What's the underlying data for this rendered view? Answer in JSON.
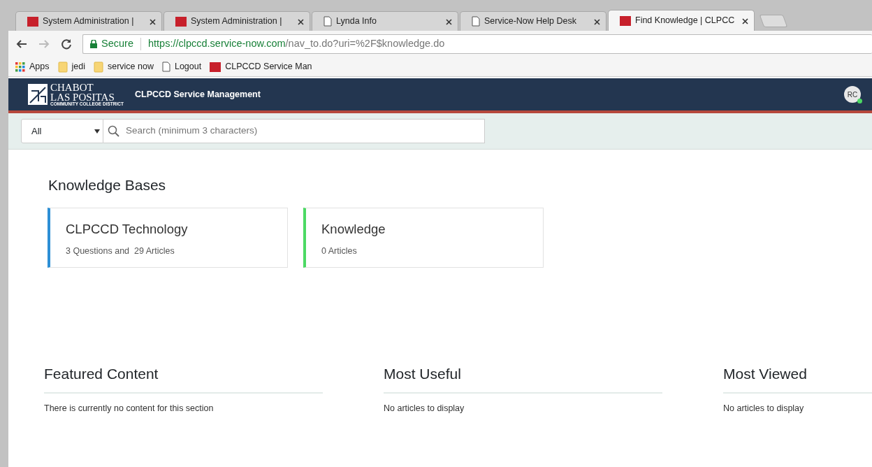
{
  "browser": {
    "tabs": [
      {
        "title": "System Administration |",
        "kind": "now",
        "selected": false
      },
      {
        "title": "System Administration |",
        "kind": "now",
        "selected": false
      },
      {
        "title": "Lynda Info",
        "kind": "page",
        "selected": false
      },
      {
        "title": "Service-Now Help Desk",
        "kind": "page",
        "selected": false
      },
      {
        "title": "Find Knowledge | CLPCC",
        "kind": "now",
        "selected": true
      }
    ],
    "security": "Secure",
    "url_host": "https://clpccd.service-now.com",
    "url_path": "/nav_to.do?uri=%2F$knowledge.do",
    "bookmarks": [
      {
        "label": "Apps",
        "kind": "apps"
      },
      {
        "label": "jedi",
        "kind": "folder"
      },
      {
        "label": "service now",
        "kind": "folder"
      },
      {
        "label": "Logout",
        "kind": "page"
      },
      {
        "label": "CLPCCD Service Man",
        "kind": "now"
      }
    ]
  },
  "header": {
    "logo_line1": "CHABOT",
    "logo_line2": "LAS POSITAS",
    "logo_line3": "COMMUNITY COLLEGE DISTRICT",
    "title": "CLPCCD Service Management",
    "avatar": "RC",
    "online": true
  },
  "search": {
    "scope": "All",
    "placeholder": "Search (minimum 3 characters)"
  },
  "knowledge_bases": {
    "heading": "Knowledge Bases",
    "items": [
      {
        "name": "CLPCCD Technology",
        "summary": "3 Questions and  29 Articles",
        "color": "#2d8fd5"
      },
      {
        "name": "Knowledge",
        "summary": "0 Articles",
        "color": "#4cd964"
      }
    ]
  },
  "sections": [
    {
      "heading": "Featured Content",
      "message": "There is currently no content for this section"
    },
    {
      "heading": "Most Useful",
      "message": "No articles to display"
    },
    {
      "heading": "Most Viewed",
      "message": "No articles to display"
    }
  ]
}
